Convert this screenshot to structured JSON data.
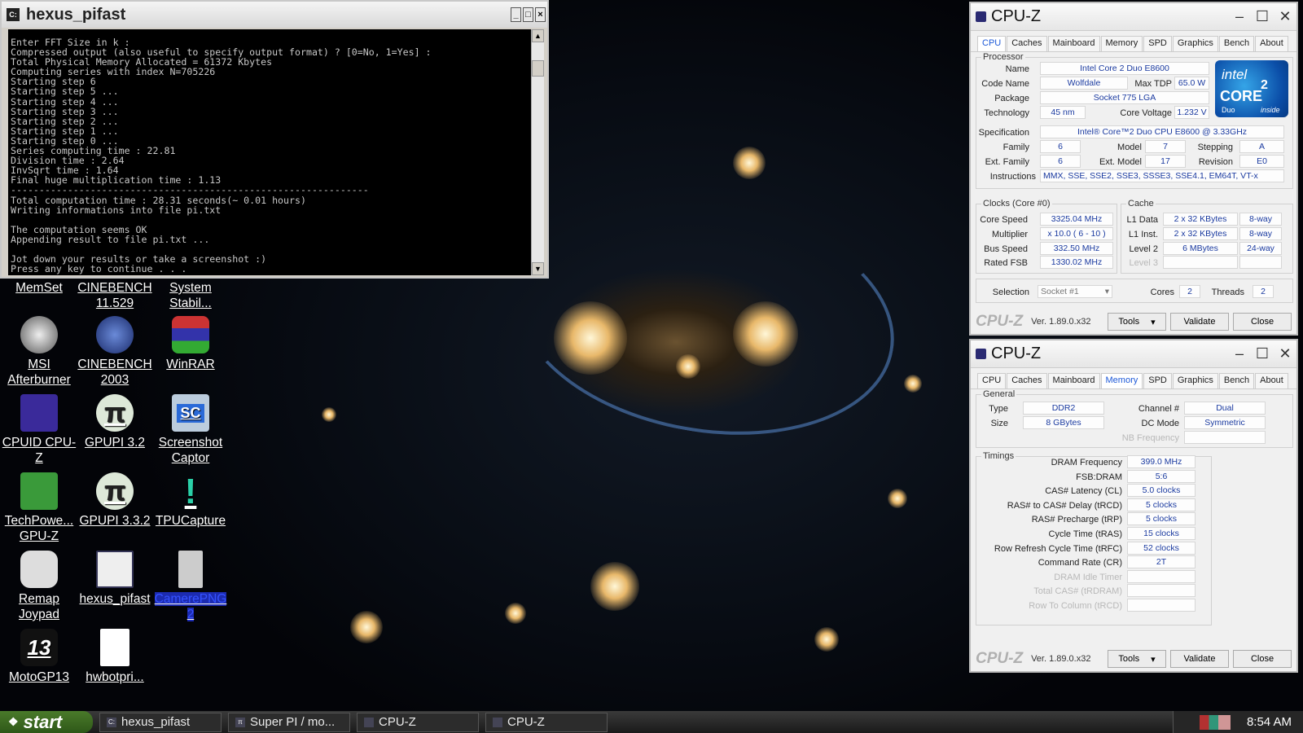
{
  "console": {
    "title": "hexus_pifast",
    "lines": "Enter FFT Size in k :\nCompressed output (also useful to specify output format) ? [0=No, 1=Yes] :\nTotal Physical Memory Allocated = 61372 Kbytes\nComputing series with index N=705226\nStarting step 6\nStarting step 5 ...\nStarting step 4 ...\nStarting step 3 ...\nStarting step 2 ...\nStarting step 1 ...\nStarting step 0 ...\nSeries computing time : 22.81\nDivision time : 2.64\nInvSqrt time : 1.64\nFinal huge multiplication time : 1.13\n---------------------------------------------------------------\nTotal computation time : 28.31 seconds(~ 0.01 hours)\nWriting informations into file pi.txt\n\nThe computation seems OK\nAppending result to file pi.txt ...\n\nJot down your results or take a screenshot :)\nPress any key to continue . . ."
  },
  "desktop_icons": [
    {
      "label": "MemSet",
      "icon": "memset-icon"
    },
    {
      "label": "CINEBENCH 11.529",
      "icon": "cinebench-icon"
    },
    {
      "label": "System Stabil...",
      "icon": "system-stability-icon"
    },
    {
      "label": "MSI Afterburner",
      "icon": "msi-afterburner-icon"
    },
    {
      "label": "CINEBENCH 2003",
      "icon": "cinebench-2003-icon"
    },
    {
      "label": "WinRAR",
      "icon": "winrar-icon"
    },
    {
      "label": "CPUID CPU-Z",
      "icon": "cpuz-icon"
    },
    {
      "label": "GPUPI 3.2",
      "icon": "pi-icon"
    },
    {
      "label": "Screenshot Captor",
      "icon": "screenshot-captor-icon"
    },
    {
      "label": "TechPowe... GPU-Z",
      "icon": "gpuz-icon"
    },
    {
      "label": "GPUPI 3.3.2",
      "icon": "pi-icon"
    },
    {
      "label": "TPUCapture",
      "icon": "tpucapture-icon"
    },
    {
      "label": "Remap Joypad",
      "icon": "joypad-icon"
    },
    {
      "label": "hexus_pifast",
      "icon": "pifast-icon"
    },
    {
      "label": "CamerePNG 2",
      "icon": "png-file-icon"
    },
    {
      "label": "MotoGP13",
      "icon": "motogp-icon"
    },
    {
      "label": "hwbotpri...",
      "icon": "text-file-icon"
    }
  ],
  "sc_text": "SC",
  "cpuz_top": {
    "title": "CPU-Z",
    "tabs": [
      "CPU",
      "Caches",
      "Mainboard",
      "Memory",
      "SPD",
      "Graphics",
      "Bench",
      "About"
    ],
    "processor_caption": "Processor",
    "labels": {
      "name": "Name",
      "codename": "Code Name",
      "maxtdp": "Max TDP",
      "package": "Package",
      "technology": "Technology",
      "corevoltage": "Core Voltage",
      "specification": "Specification",
      "family": "Family",
      "model": "Model",
      "stepping": "Stepping",
      "extfamily": "Ext. Family",
      "extmodel": "Ext. Model",
      "revision": "Revision",
      "instructions": "Instructions"
    },
    "values": {
      "name": "Intel Core 2 Duo E8600",
      "codename": "Wolfdale",
      "maxtdp": "65.0 W",
      "package": "Socket 775 LGA",
      "technology": "45 nm",
      "corevoltage": "1.232 V",
      "specification": "Intel® Core™2 Duo CPU     E8600  @ 3.33GHz",
      "family": "6",
      "model": "7",
      "stepping": "A",
      "extfamily": "6",
      "extmodel": "17",
      "revision": "E0",
      "instructions": "MMX, SSE, SSE2, SSE3, SSSE3, SSE4.1, EM64T, VT-x"
    },
    "intel_logo": {
      "brand": "intel",
      "line1": "CORE",
      "line2": "2",
      "line3": "Duo",
      "line4": "inside"
    },
    "clocks_caption": "Clocks (Core #0)",
    "clocks": [
      {
        "label": "Core Speed",
        "value": "3325.04 MHz"
      },
      {
        "label": "Multiplier",
        "value": "x 10.0 ( 6 - 10 )"
      },
      {
        "label": "Bus Speed",
        "value": "332.50 MHz"
      },
      {
        "label": "Rated FSB",
        "value": "1330.02 MHz"
      }
    ],
    "cache_caption": "Cache",
    "cache": [
      {
        "label": "L1 Data",
        "size": "2 x 32 KBytes",
        "way": "8-way"
      },
      {
        "label": "L1 Inst.",
        "size": "2 x 32 KBytes",
        "way": "8-way"
      },
      {
        "label": "Level 2",
        "size": "6 MBytes",
        "way": "24-way"
      },
      {
        "label": "Level 3",
        "size": "",
        "way": ""
      }
    ],
    "selection_label": "Selection",
    "selection_value": "Socket #1",
    "cores_label": "Cores",
    "cores": "2",
    "threads_label": "Threads",
    "threads": "2",
    "brand": "CPU-Z",
    "version": "Ver. 1.89.0.x32",
    "tools": "Tools",
    "validate": "Validate",
    "close": "Close"
  },
  "cpuz_bottom": {
    "title": "CPU-Z",
    "tabs": [
      "CPU",
      "Caches",
      "Mainboard",
      "Memory",
      "SPD",
      "Graphics",
      "Bench",
      "About"
    ],
    "general_caption": "General",
    "type_label": "Type",
    "type": "DDR2",
    "size_label": "Size",
    "size": "8 GBytes",
    "channel_label": "Channel #",
    "channel": "Dual",
    "dcmode_label": "DC Mode",
    "dcmode": "Symmetric",
    "nbfreq_label": "NB Frequency",
    "nbfreq": "",
    "timings_caption": "Timings",
    "timings": [
      {
        "label": "DRAM Frequency",
        "value": "399.0 MHz",
        "dim": false
      },
      {
        "label": "FSB:DRAM",
        "value": "5:6",
        "dim": false
      },
      {
        "label": "CAS# Latency (CL)",
        "value": "5.0 clocks",
        "dim": false
      },
      {
        "label": "RAS# to CAS# Delay (tRCD)",
        "value": "5 clocks",
        "dim": false
      },
      {
        "label": "RAS# Precharge (tRP)",
        "value": "5 clocks",
        "dim": false
      },
      {
        "label": "Cycle Time (tRAS)",
        "value": "15 clocks",
        "dim": false
      },
      {
        "label": "Row Refresh Cycle Time (tRFC)",
        "value": "52 clocks",
        "dim": false
      },
      {
        "label": "Command Rate (CR)",
        "value": "2T",
        "dim": false
      },
      {
        "label": "DRAM Idle Timer",
        "value": "",
        "dim": true
      },
      {
        "label": "Total CAS# (tRDRAM)",
        "value": "",
        "dim": true
      },
      {
        "label": "Row To Column (tRCD)",
        "value": "",
        "dim": true
      }
    ],
    "brand": "CPU-Z",
    "version": "Ver. 1.89.0.x32",
    "tools": "Tools",
    "validate": "Validate",
    "close": "Close"
  },
  "taskbar": {
    "start": "start",
    "items": [
      {
        "label": "hexus_pifast"
      },
      {
        "label": "Super PI / mo..."
      },
      {
        "label": "CPU-Z"
      },
      {
        "label": "CPU-Z"
      }
    ],
    "clock": "8:54 AM"
  }
}
